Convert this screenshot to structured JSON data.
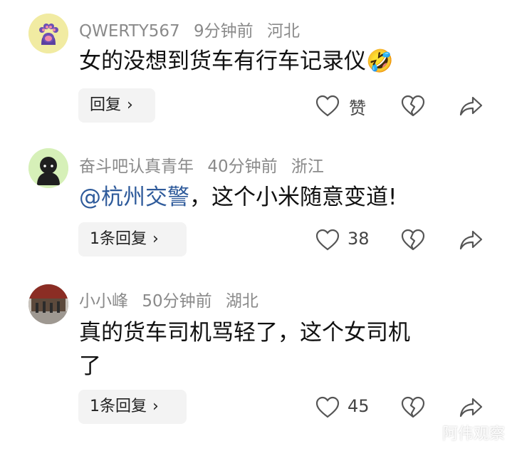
{
  "comments": [
    {
      "username": "QWERTY567",
      "time": "9分钟前",
      "location": "河北",
      "text": "女的没想到货车有行车记录仪",
      "emoji": "🤣",
      "reply_label": "回复",
      "like_label": "赞"
    },
    {
      "username": "奋斗吧认真青年",
      "time": "40分钟前",
      "location": "浙江",
      "mention": "@杭州交警",
      "text": "，这个小米随意变道!",
      "reply_label": "1条回复",
      "like_count": "38"
    },
    {
      "username": "小小峰",
      "time": "50分钟前",
      "location": "湖北",
      "text_line1": "真的货车司机骂轻了，这个女司机",
      "text_line2": "了",
      "reply_label": "1条回复",
      "like_count": "45"
    }
  ],
  "chevron": "›",
  "watermark": "阿伟观察",
  "colors": {
    "mention": "#2f5b9b",
    "meta": "#8a8a8a",
    "pill_bg": "#f3f3f3"
  },
  "icons": [
    "paw-icon",
    "heart-outline-icon",
    "broken-heart-icon",
    "share-arrow-icon"
  ]
}
